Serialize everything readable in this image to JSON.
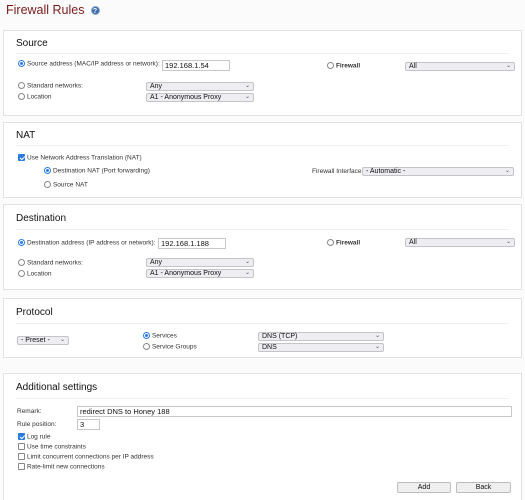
{
  "page": {
    "title": "Firewall Rules",
    "help_icon": "question-circle-icon"
  },
  "source": {
    "heading": "Source",
    "address_label": "Source address (MAC/IP address or network):",
    "address_value": "192.168.1.54",
    "address_selected": true,
    "firewall_label": "Firewall",
    "firewall_select": "All",
    "standard_networks_label": "Standard networks:",
    "standard_networks_value": "Any",
    "location_label": "Location",
    "location_value": "A1 - Anonymous Proxy"
  },
  "nat": {
    "heading": "NAT",
    "use_nat_label": "Use Network Address Translation (NAT)",
    "use_nat_checked": true,
    "dnat_label": "Destination NAT (Port forwarding)",
    "snat_label": "Source NAT",
    "firewall_interface_label": "Firewall Interface:",
    "firewall_interface_value": "- Automatic -"
  },
  "destination": {
    "heading": "Destination",
    "address_label": "Destination address (IP address or network):",
    "address_value": "192.168.1.188",
    "firewall_label": "Firewall",
    "firewall_select": "All",
    "standard_networks_label": "Standard networks:",
    "standard_networks_value": "Any",
    "location_label": "Location",
    "location_value": "A1 - Anonymous Proxy"
  },
  "protocol": {
    "heading": "Protocol",
    "preset_value": "- Preset -",
    "services_label": "Services",
    "services_value": "DNS (TCP)",
    "service_groups_label": "Service Groups",
    "service_groups_value": "DNS"
  },
  "additional": {
    "heading": "Additional settings",
    "remark_label": "Remark:",
    "remark_value": "redirect DNS to Honey 188",
    "rule_position_label": "Rule position:",
    "rule_position_value": "3",
    "log_rule_label": "Log rule",
    "time_constraints_label": "Use time constraints",
    "limit_connections_label": "Limit concurrent connections per IP address",
    "rate_limit_label": "Rate-limit new connections"
  },
  "actions": {
    "add_label": "Add",
    "back_label": "Back"
  }
}
